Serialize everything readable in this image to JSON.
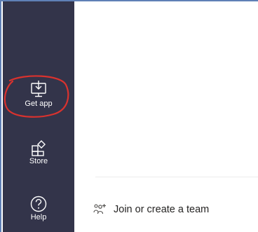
{
  "rail": {
    "items": [
      {
        "label": "Get app",
        "icon": "download-monitor-icon"
      },
      {
        "label": "Store",
        "icon": "store-icon"
      },
      {
        "label": "Help",
        "icon": "help-icon"
      }
    ]
  },
  "main": {
    "join_label": "Join or create a team",
    "join_icon": "people-add-icon"
  },
  "colors": {
    "rail_bg": "#33344a",
    "highlight": "#d9322e",
    "text": "#252423",
    "window_border": "#5f80b6"
  }
}
